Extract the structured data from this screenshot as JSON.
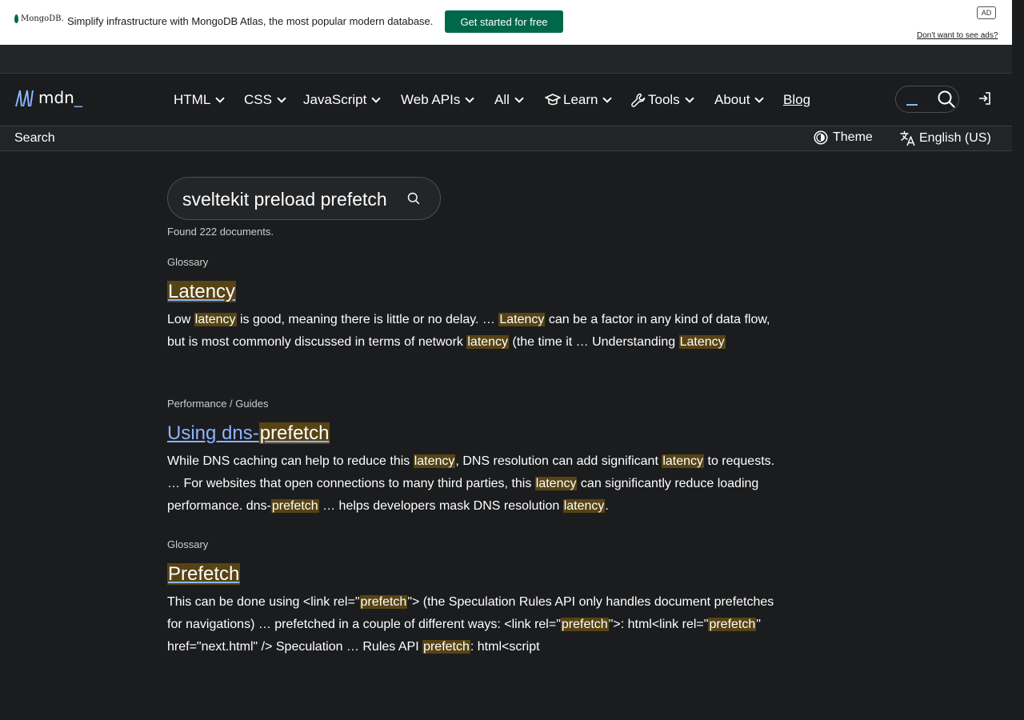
{
  "ad": {
    "logo_text": "MongoDB.",
    "text": "Simplify infrastructure with MongoDB Atlas, the most popular modern database.",
    "cta": "Get started for free",
    "tag": "AD",
    "dismiss": "Don't want to see ads?"
  },
  "header": {
    "logo": "mdn",
    "nav": [
      {
        "label": "HTML"
      },
      {
        "label": "CSS"
      },
      {
        "label": "JavaScript"
      },
      {
        "label": "Web APIs"
      },
      {
        "label": "All"
      },
      {
        "label": "Learn",
        "icon": "graduation-cap-icon"
      },
      {
        "label": "Tools",
        "icon": "wrench-icon"
      },
      {
        "label": "About"
      },
      {
        "label": "Blog"
      }
    ]
  },
  "subheader": {
    "title": "Search",
    "theme": "Theme",
    "language": "English (US)"
  },
  "search": {
    "query": "sveltekit preload prefetch",
    "found": "Found 222 documents."
  },
  "results": [
    {
      "crumb": "Glossary",
      "title_parts": [
        {
          "t": "Latency",
          "h": true
        }
      ],
      "snippet_parts": [
        {
          "t": "Low "
        },
        {
          "t": "latency",
          "h": true
        },
        {
          "t": " is good, meaning there is little or no delay. … "
        },
        {
          "t": "Latency",
          "h": true
        },
        {
          "t": " can be a factor in any kind of data flow, but is most commonly discussed in terms of network "
        },
        {
          "t": "latency",
          "h": true
        },
        {
          "t": " (the time it … Understanding "
        },
        {
          "t": "Latency",
          "h": true
        }
      ]
    },
    {
      "crumb": "Performance / Guides",
      "title_parts": [
        {
          "t": "Using dns-"
        },
        {
          "t": "prefetch",
          "h": true
        }
      ],
      "snippet_parts": [
        {
          "t": "While DNS caching can help to reduce this "
        },
        {
          "t": "latency",
          "h": true
        },
        {
          "t": ", DNS resolution can add significant "
        },
        {
          "t": "latency",
          "h": true
        },
        {
          "t": " to requests. … For websites that open connections to many third parties, this "
        },
        {
          "t": "latency",
          "h": true
        },
        {
          "t": " can significantly reduce loading performance. dns-"
        },
        {
          "t": "prefetch",
          "h": true
        },
        {
          "t": " … helps developers mask DNS resolution "
        },
        {
          "t": "latency",
          "h": true
        },
        {
          "t": "."
        }
      ]
    },
    {
      "crumb": "Glossary",
      "title_parts": [
        {
          "t": "Prefetch",
          "h": true
        }
      ],
      "snippet_parts": [
        {
          "t": "This can be done using <link rel=\""
        },
        {
          "t": "prefetch",
          "h": true
        },
        {
          "t": "\"> (the Speculation Rules API only handles document prefetches for navigations) … prefetched in a couple of different ways: <link rel=\""
        },
        {
          "t": "prefetch",
          "h": true
        },
        {
          "t": "\">: html<link rel=\""
        },
        {
          "t": "prefetch",
          "h": true
        },
        {
          "t": "\" href=\"next.html\" /> Speculation … Rules API "
        },
        {
          "t": "prefetch",
          "h": true
        },
        {
          "t": ": html<script"
        }
      ]
    }
  ]
}
